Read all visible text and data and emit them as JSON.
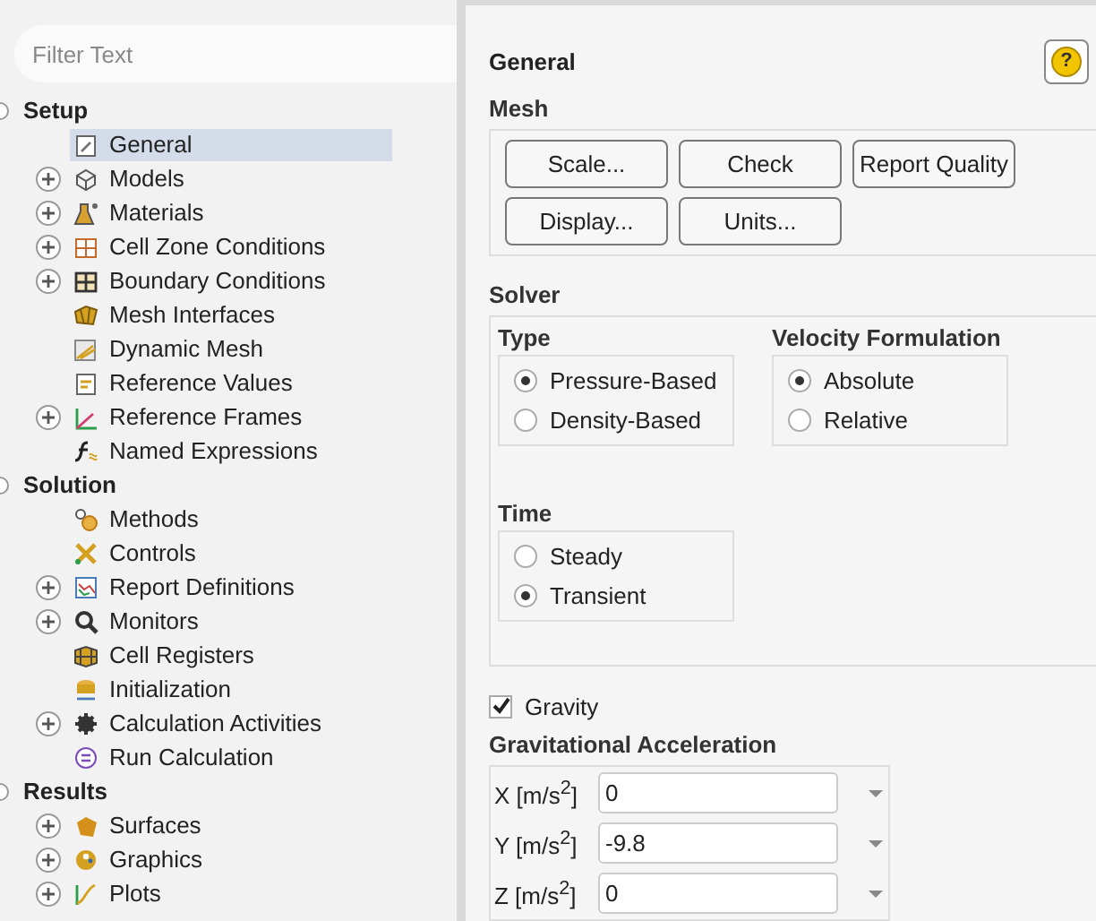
{
  "filter": {
    "placeholder": "Filter Text"
  },
  "tree": [
    {
      "label": "Setup",
      "expanded": true,
      "children": [
        {
          "label": "General",
          "expandable": false,
          "selected": true
        },
        {
          "label": "Models",
          "expandable": true,
          "selected": false
        },
        {
          "label": "Materials",
          "expandable": true,
          "selected": false
        },
        {
          "label": "Cell Zone Conditions",
          "expandable": true,
          "selected": false
        },
        {
          "label": "Boundary Conditions",
          "expandable": true,
          "selected": false
        },
        {
          "label": "Mesh Interfaces",
          "expandable": false,
          "selected": false
        },
        {
          "label": "Dynamic Mesh",
          "expandable": false,
          "selected": false
        },
        {
          "label": "Reference Values",
          "expandable": false,
          "selected": false
        },
        {
          "label": "Reference Frames",
          "expandable": true,
          "selected": false
        },
        {
          "label": "Named Expressions",
          "expandable": false,
          "selected": false
        }
      ]
    },
    {
      "label": "Solution",
      "expanded": true,
      "children": [
        {
          "label": "Methods",
          "expandable": false,
          "selected": false
        },
        {
          "label": "Controls",
          "expandable": false,
          "selected": false
        },
        {
          "label": "Report Definitions",
          "expandable": true,
          "selected": false
        },
        {
          "label": "Monitors",
          "expandable": true,
          "selected": false
        },
        {
          "label": "Cell Registers",
          "expandable": false,
          "selected": false
        },
        {
          "label": "Initialization",
          "expandable": false,
          "selected": false
        },
        {
          "label": "Calculation Activities",
          "expandable": true,
          "selected": false
        },
        {
          "label": "Run Calculation",
          "expandable": false,
          "selected": false
        }
      ]
    },
    {
      "label": "Results",
      "expanded": true,
      "children": [
        {
          "label": "Surfaces",
          "expandable": true,
          "selected": false
        },
        {
          "label": "Graphics",
          "expandable": true,
          "selected": false
        },
        {
          "label": "Plots",
          "expandable": true,
          "selected": false
        }
      ]
    }
  ],
  "panel": {
    "title": "General",
    "help": "?",
    "mesh": {
      "label": "Mesh",
      "buttons": [
        [
          "Scale...",
          "Check",
          "Report Quality"
        ],
        [
          "Display...",
          "Units..."
        ]
      ]
    },
    "solver": {
      "label": "Solver",
      "groups": [
        {
          "label": "Type",
          "options": [
            {
              "label": "Pressure-Based",
              "selected": true
            },
            {
              "label": "Density-Based",
              "selected": false
            }
          ]
        },
        {
          "label": "Velocity Formulation",
          "options": [
            {
              "label": "Absolute",
              "selected": true
            },
            {
              "label": "Relative",
              "selected": false
            }
          ]
        },
        {
          "label": "Time",
          "options": [
            {
              "label": "Steady",
              "selected": false
            },
            {
              "label": "Transient",
              "selected": true
            }
          ]
        }
      ]
    },
    "gravity": {
      "label": "Gravity",
      "checked": true
    },
    "acceleration": {
      "label": "Gravitational Acceleration",
      "rows": [
        {
          "label": "X [m/s$^{2}$]",
          "value": "0"
        },
        {
          "label": "Y [m/s$^{2}$]",
          "value": "-9.8"
        },
        {
          "label": "Z [m/s$^{2}$]",
          "value": "0"
        }
      ]
    }
  }
}
